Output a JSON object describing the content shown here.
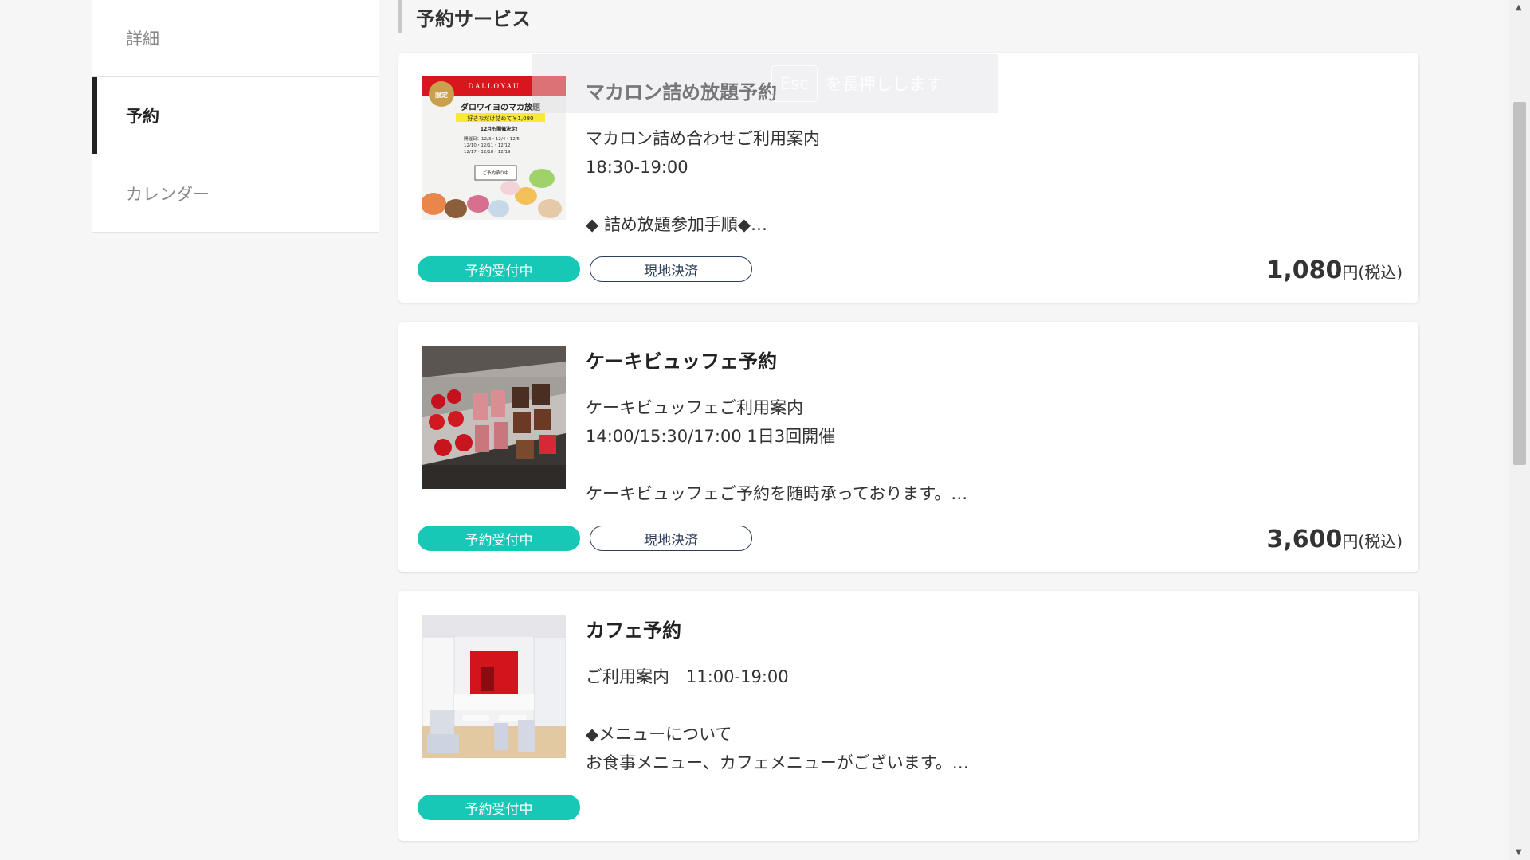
{
  "sidebar": {
    "items": [
      {
        "label": "詳細"
      },
      {
        "label": "予約"
      },
      {
        "label": "カレンダー"
      }
    ]
  },
  "main": {
    "section_title": "予約サービス",
    "services": [
      {
        "title": "マカロン詰め放題予約",
        "desc": "マカロン詰め合わせご利用案内\n18:30-19:00\n\n◆ 詰め放題参加手順◆…",
        "status": "予約受付中",
        "payment": "現地決済",
        "price": "1,080",
        "price_unit": "円(税込)",
        "image": {
          "brand": "DALLOYAU",
          "tag": "限定",
          "headline": "ダロワイヨのマカ放題",
          "sub": "好きなだけ詰めて￥1,080",
          "date_note": "12月も開催決定！",
          "schedule": "開催日：12/3・12/4・12/5\n12/10・12/11・12/12\n12/17・12/18・12/19",
          "button": "ご予約承り中"
        }
      },
      {
        "title": "ケーキビュッフェ予約",
        "desc": "ケーキビュッフェご利用案内\n14:00/15:30/17:00 1日3回開催\n\nケーキビュッフェご予約を随時承っております。…",
        "status": "予約受付中",
        "payment": "現地決済",
        "price": "3,600",
        "price_unit": "円(税込)"
      },
      {
        "title": "カフェ予約",
        "desc": "ご利用案内　11:00-19:00\n\n◆メニューについて\nお食事メニュー、カフェメニューがございます。…",
        "status": "予約受付中"
      }
    ]
  },
  "overlay": {
    "pre": "、",
    "key": "Esc",
    "text": "を長押しします"
  },
  "colors": {
    "status_badge": "#18c8b7",
    "payment_border": "#2d3e5a",
    "active_marker": "#222222"
  }
}
